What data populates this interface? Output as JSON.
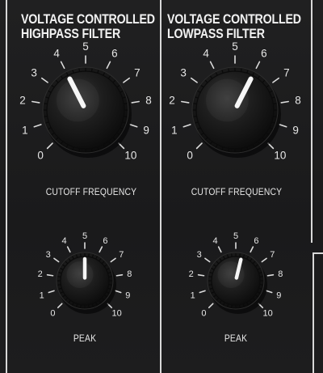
{
  "modules": [
    {
      "title_line1": "VOLTAGE CONTROLLED",
      "title_line2": "HIGHPASS FILTER",
      "cutoff": {
        "label": "CUTOFF FREQUENCY",
        "value": 4.0
      },
      "peak": {
        "label": "PEAK",
        "value": 5.0
      }
    },
    {
      "title_line1": "VOLTAGE CONTROLLED",
      "title_line2": "LOWPASS FILTER",
      "cutoff": {
        "label": "CUTOFF FREQUENCY",
        "value": 6.0
      },
      "peak": {
        "label": "PEAK",
        "value": 5.5
      }
    }
  ],
  "scale": [
    "0",
    "1",
    "2",
    "3",
    "4",
    "5",
    "6",
    "7",
    "8",
    "9",
    "10"
  ],
  "colors": {
    "panel": "#1c1c1d",
    "text": "#eeeeee",
    "knob": "#151515",
    "indicator": "#f4f4f4"
  }
}
